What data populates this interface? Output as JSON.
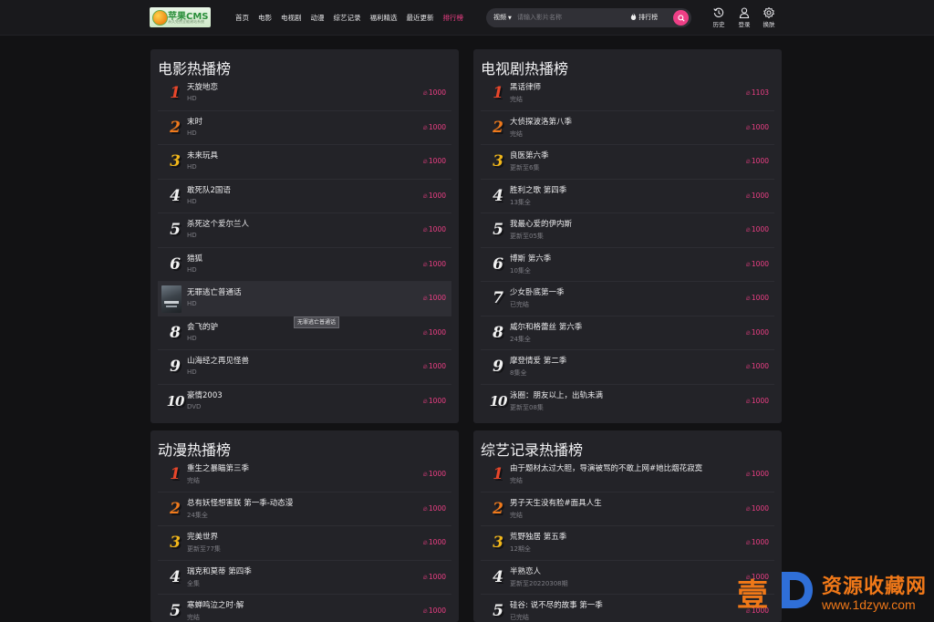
{
  "header": {
    "logo": {
      "brand": "苹果CMS",
      "slogan": "永久免费全能建站系统"
    },
    "nav": [
      {
        "label": "首页",
        "active": false
      },
      {
        "label": "电影",
        "active": false
      },
      {
        "label": "电视剧",
        "active": false
      },
      {
        "label": "动漫",
        "active": false
      },
      {
        "label": "综艺记录",
        "active": false
      },
      {
        "label": "福利精选",
        "active": false
      },
      {
        "label": "最近更新",
        "active": false
      },
      {
        "label": "排行榜",
        "active": true
      }
    ],
    "search": {
      "category": "视频",
      "placeholder": "请输入影片名称",
      "rank_label": "排行榜",
      "query": ""
    },
    "actions": {
      "history": "历史",
      "login": "登录",
      "skin": "换肤"
    }
  },
  "colors": {
    "accent": "#ef3f86",
    "rank1": "#e8462a",
    "rank2": "#f07a1c",
    "rank3": "#f2b71a",
    "panel_bg": "#232328",
    "page_bg": "#121214"
  },
  "panels": {
    "movies": {
      "title": "电影热播榜",
      "items": [
        {
          "rank": "1",
          "title": "天旋地恋",
          "sub": "HD",
          "heat": "1000"
        },
        {
          "rank": "2",
          "title": "末时",
          "sub": "HD",
          "heat": "1000"
        },
        {
          "rank": "3",
          "title": "未来玩具",
          "sub": "HD",
          "heat": "1000"
        },
        {
          "rank": "4",
          "title": "敢死队2国语",
          "sub": "HD",
          "heat": "1000"
        },
        {
          "rank": "5",
          "title": "杀死这个爱尔兰人",
          "sub": "HD",
          "heat": "1000"
        },
        {
          "rank": "6",
          "title": "猎狐",
          "sub": "HD",
          "heat": "1000"
        },
        {
          "rank": "7",
          "title": "无罪逃亡普通话",
          "sub": "HD",
          "heat": "1000"
        },
        {
          "rank": "8",
          "title": "会飞的驴",
          "sub": "HD",
          "heat": "1000"
        },
        {
          "rank": "9",
          "title": "山海经之再见怪兽",
          "sub": "HD",
          "heat": "1000"
        },
        {
          "rank": "10",
          "title": "豪情2003",
          "sub": "DVD",
          "heat": "1000"
        }
      ],
      "tooltip": "无罪逃亡普通话"
    },
    "tv": {
      "title": "电视剧热播榜",
      "items": [
        {
          "rank": "1",
          "title": "黑话律师",
          "sub": "完结",
          "heat": "1103"
        },
        {
          "rank": "2",
          "title": "大侦探波洛第八季",
          "sub": "完结",
          "heat": "1000"
        },
        {
          "rank": "3",
          "title": "良医第六季",
          "sub": "更新至6集",
          "heat": "1000"
        },
        {
          "rank": "4",
          "title": "胜利之歌 第四季",
          "sub": "13集全",
          "heat": "1000"
        },
        {
          "rank": "5",
          "title": "我最心爱的伊内斯",
          "sub": "更新至05集",
          "heat": "1000"
        },
        {
          "rank": "6",
          "title": "博斯 第六季",
          "sub": "10集全",
          "heat": "1000"
        },
        {
          "rank": "7",
          "title": "少女卧底第一季",
          "sub": "已完结",
          "heat": "1000"
        },
        {
          "rank": "8",
          "title": "威尔和格蕾丝 第六季",
          "sub": "24集全",
          "heat": "1000"
        },
        {
          "rank": "9",
          "title": "摩登情爱 第二季",
          "sub": "8集全",
          "heat": "1000"
        },
        {
          "rank": "10",
          "title": "泳圈：朋友以上，出轨未满",
          "sub": "更新至08集",
          "heat": "1000"
        }
      ]
    },
    "anime": {
      "title": "动漫热播榜",
      "items": [
        {
          "rank": "1",
          "title": "重生之暴瞄第三季",
          "sub": "完结",
          "heat": "1000"
        },
        {
          "rank": "2",
          "title": "总有妖怪想害朕 第一季-动态漫",
          "sub": "24集全",
          "heat": "1000"
        },
        {
          "rank": "3",
          "title": "完美世界",
          "sub": "更新至77集",
          "heat": "1000"
        },
        {
          "rank": "4",
          "title": "瑞克和莫蒂 第四季",
          "sub": "全集",
          "heat": "1000"
        },
        {
          "rank": "5",
          "title": "寒蝉鸣泣之时·解",
          "sub": "完结",
          "heat": "1000"
        }
      ]
    },
    "variety": {
      "title": "综艺记录热播榜",
      "items": [
        {
          "rank": "1",
          "title": "由于题材太过大胆，导演被骂的不敢上网#她比烟花寂寞",
          "sub": "完结",
          "heat": "1000"
        },
        {
          "rank": "2",
          "title": "男子天生没有脸#面具人生",
          "sub": "完结",
          "heat": "1000"
        },
        {
          "rank": "3",
          "title": "荒野独居 第五季",
          "sub": "12期全",
          "heat": "1000"
        },
        {
          "rank": "4",
          "title": "半熟恋人",
          "sub": "更新至20220308期",
          "heat": "1000"
        },
        {
          "rank": "5",
          "title": "硅谷: 说不尽的故事 第一季",
          "sub": "已完结",
          "heat": "1000"
        }
      ]
    }
  },
  "watermark": {
    "char": "壹",
    "name": "资源收藏网",
    "url": "www.1dzyw.com"
  }
}
